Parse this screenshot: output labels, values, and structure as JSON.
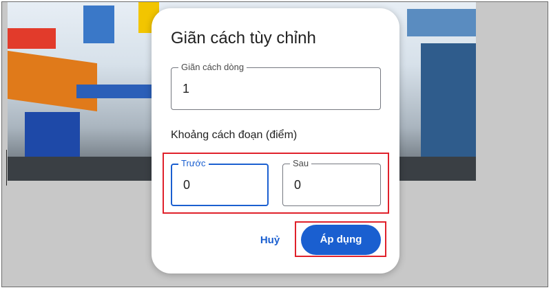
{
  "dialog": {
    "title": "Giãn cách tùy chỉnh",
    "line_spacing": {
      "label": "Giãn cách dòng",
      "value": "1"
    },
    "paragraph_section_label": "Khoảng cách đoạn (điểm)",
    "before": {
      "label": "Trước",
      "value": "0"
    },
    "after": {
      "label": "Sau",
      "value": "0"
    },
    "cancel_label": "Huỷ",
    "apply_label": "Áp dụng"
  },
  "background": {
    "description_text": []
  },
  "colors": {
    "accent": "#1a5fd0",
    "highlight": "#e0202a",
    "scrim": "#c8c8c8"
  }
}
